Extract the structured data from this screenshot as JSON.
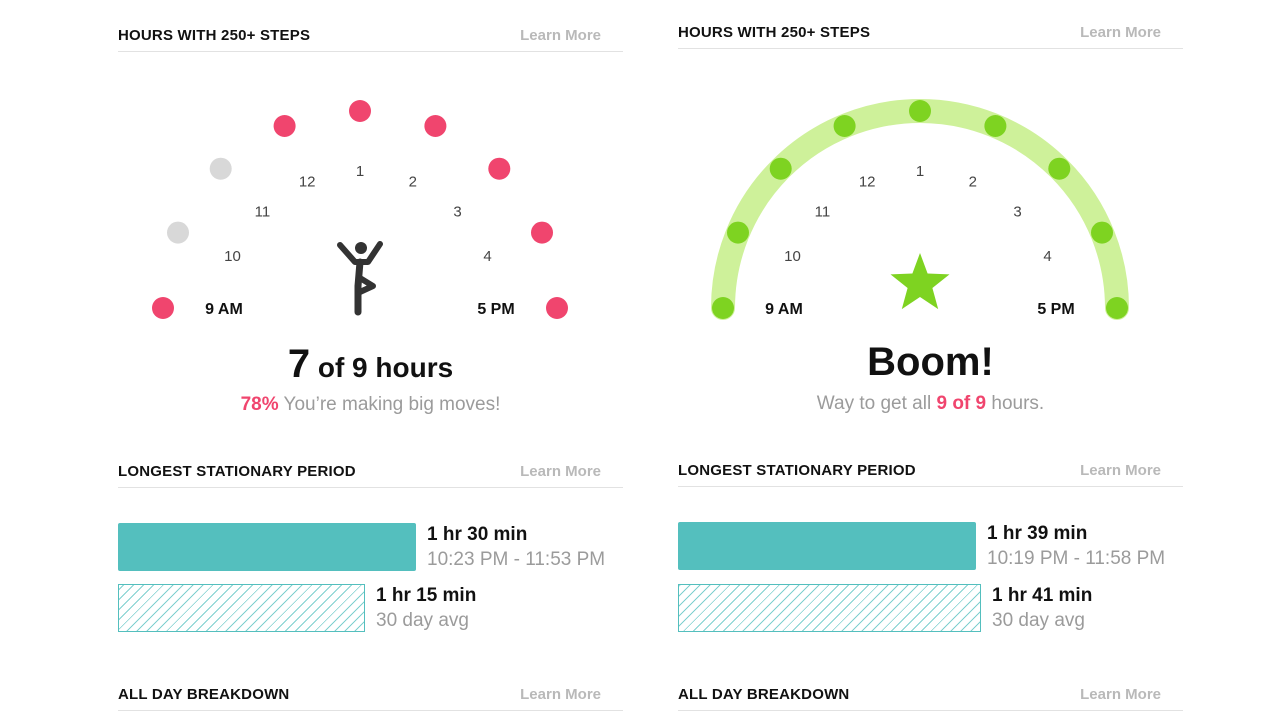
{
  "colors": {
    "active": "#f0456e",
    "inactive": "#d8d8d8",
    "goal_dot": "#7ed321",
    "goal_arc": "#cef19a",
    "bar": "#54bfbe"
  },
  "left": {
    "hourly": {
      "title": "HOURS WITH 250+ STEPS",
      "learn_more": "Learn More",
      "hours": [
        {
          "label": "9 AM",
          "active": true
        },
        {
          "label": "10",
          "active": false
        },
        {
          "label": "11",
          "active": false
        },
        {
          "label": "12",
          "active": true
        },
        {
          "label": "1",
          "active": true
        },
        {
          "label": "2",
          "active": true
        },
        {
          "label": "3",
          "active": true
        },
        {
          "label": "4",
          "active": true
        },
        {
          "label": "5 PM",
          "active": true
        }
      ],
      "center_icon": "standing-figure-icon",
      "count": "7",
      "count_suffix": " of 9 hours",
      "percent": "78%",
      "message": " You’re making big moves!"
    },
    "stationary": {
      "title": "LONGEST STATIONARY PERIOD",
      "learn_more": "Learn More",
      "today_duration": "1 hr 30 min",
      "today_range": "10:23 PM - 11:53 PM",
      "avg_duration": "1 hr 15 min",
      "avg_label": "30 day avg",
      "today_fraction": 0.59,
      "avg_fraction": 0.49
    },
    "breakdown": {
      "title": "ALL DAY BREAKDOWN",
      "learn_more": "Learn More"
    }
  },
  "right": {
    "hourly": {
      "title": "HOURS WITH 250+ STEPS",
      "learn_more": "Learn More",
      "hours": [
        {
          "label": "9 AM",
          "active": true
        },
        {
          "label": "10",
          "active": true
        },
        {
          "label": "11",
          "active": true
        },
        {
          "label": "12",
          "active": true
        },
        {
          "label": "1",
          "active": true
        },
        {
          "label": "2",
          "active": true
        },
        {
          "label": "3",
          "active": true
        },
        {
          "label": "4",
          "active": true
        },
        {
          "label": "5 PM",
          "active": true
        }
      ],
      "center_icon": "star-icon",
      "headline": "Boom!",
      "message_pre": "Way to get all ",
      "message_highlight": "9 of 9",
      "message_post": " hours."
    },
    "stationary": {
      "title": "LONGEST STATIONARY PERIOD",
      "learn_more": "Learn More",
      "today_duration": "1 hr 39 min",
      "today_range": "10:19 PM - 11:58 PM",
      "avg_duration": "1 hr 41 min",
      "avg_label": "30 day avg",
      "today_fraction": 0.59,
      "avg_fraction": 0.6
    },
    "breakdown": {
      "title": "ALL DAY BREAKDOWN",
      "learn_more": "Learn More"
    }
  }
}
